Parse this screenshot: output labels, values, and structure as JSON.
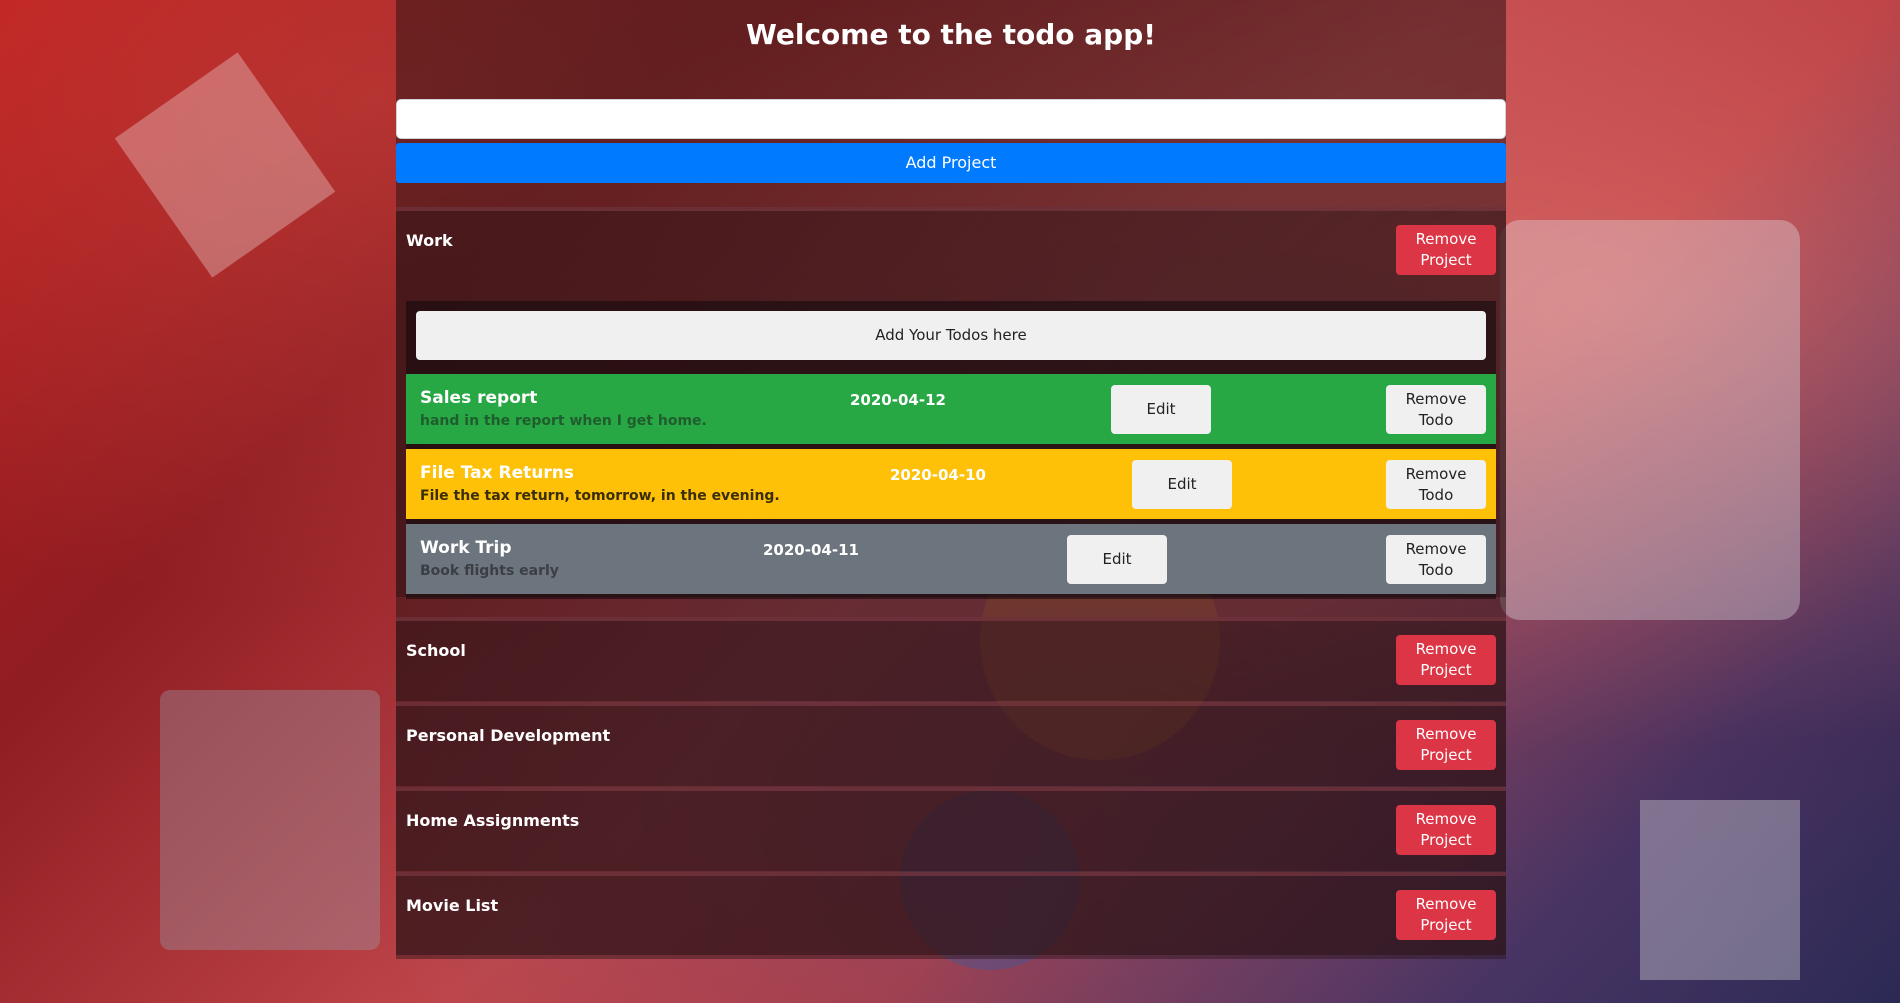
{
  "header": {
    "title": "Welcome to the todo app!"
  },
  "project_form": {
    "input_value": "",
    "input_placeholder": "",
    "add_label": "Add Project"
  },
  "projects": [
    {
      "name": "Work",
      "remove_label": "Remove Project",
      "add_todos_label": "Add Your Todos here",
      "todos": [
        {
          "title": "Sales report",
          "description": "hand in the report when I get home.",
          "date": "2020-04-12",
          "edit_label": "Edit",
          "remove_label": "Remove Todo",
          "color": "#28a745",
          "desc_color": "#1f5e2c"
        },
        {
          "title": "File Tax Returns",
          "description": "File the tax return, tomorrow, in the evening.",
          "date": "2020-04-10",
          "edit_label": "Edit",
          "remove_label": "Remove Todo",
          "color": "#ffc107",
          "desc_color": "#3a2e08"
        },
        {
          "title": "Work Trip",
          "description": "Book flights early",
          "date": "2020-04-11",
          "edit_label": "Edit",
          "remove_label": "Remove Todo",
          "color": "#6c757d",
          "desc_color": "#3b3f44"
        }
      ]
    },
    {
      "name": "School",
      "remove_label": "Remove Project"
    },
    {
      "name": "Personal Development",
      "remove_label": "Remove Project"
    },
    {
      "name": "Home Assignments",
      "remove_label": "Remove Project"
    },
    {
      "name": "Movie List",
      "remove_label": "Remove Project"
    }
  ]
}
